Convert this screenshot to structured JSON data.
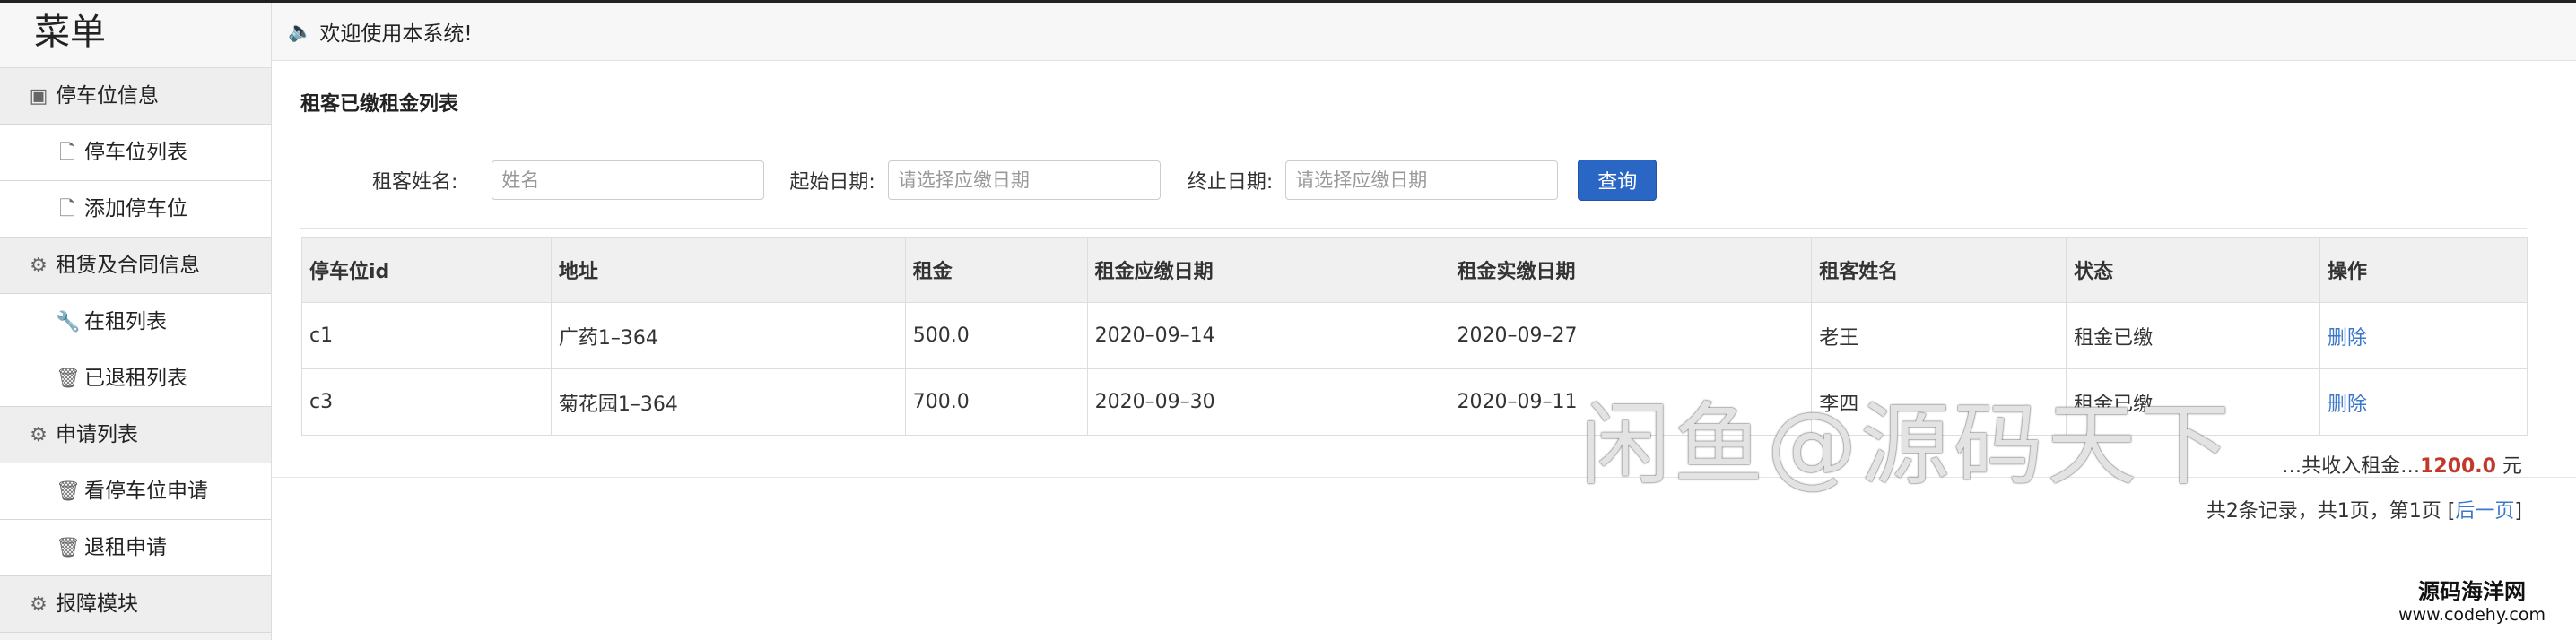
{
  "sidebar": {
    "title": "菜单",
    "items": [
      {
        "type": "head",
        "icon": "panel-icon",
        "glyph": "▣",
        "label": "停车位信息"
      },
      {
        "type": "sub",
        "icon": "file-icon",
        "glyph": "🗋",
        "label": "停车位列表"
      },
      {
        "type": "sub",
        "icon": "file-icon",
        "glyph": "🗋",
        "label": "添加停车位"
      },
      {
        "type": "head",
        "icon": "gear-icon",
        "glyph": "⚙",
        "label": "租赁及合同信息"
      },
      {
        "type": "sub",
        "icon": "wrench-icon",
        "glyph": "🔧",
        "label": "在租列表"
      },
      {
        "type": "sub",
        "icon": "trash-icon",
        "glyph": "🗑",
        "label": "已退租列表"
      },
      {
        "type": "head",
        "icon": "gear-icon",
        "glyph": "⚙",
        "label": "申请列表"
      },
      {
        "type": "sub",
        "icon": "trash-icon",
        "glyph": "🗑",
        "label": "看停车位申请"
      },
      {
        "type": "sub",
        "icon": "trash-icon",
        "glyph": "🗑",
        "label": "退租申请"
      },
      {
        "type": "head",
        "icon": "gear-icon",
        "glyph": "⚙",
        "label": "报障模块"
      }
    ]
  },
  "header": {
    "welcome": "欢迎使用本系统!",
    "speaker_icon": "speaker-icon"
  },
  "main": {
    "title": "租客已缴租金列表",
    "search": {
      "name_label": "租客姓名:",
      "name_placeholder": "姓名",
      "name_value": "",
      "start_label": "起始日期:",
      "start_placeholder": "请选择应缴日期",
      "start_value": "",
      "end_label": "终止日期:",
      "end_placeholder": "请选择应缴日期",
      "end_value": "",
      "button": "查询"
    },
    "table": {
      "columns": [
        "停车位id",
        "地址",
        "租金",
        "租金应缴日期",
        "租金实缴日期",
        "租客姓名",
        "状态",
        "操作"
      ],
      "rows": [
        [
          "c1",
          "广药1–364",
          "500.0",
          "2020–09–14",
          "2020–09–27",
          "老王",
          "租金已缴",
          "删除"
        ],
        [
          "c3",
          "菊花园1–364",
          "700.0",
          "2020–09–30",
          "2020–09–11",
          "李四",
          "租金已缴",
          "删除"
        ]
      ]
    },
    "summary": {
      "prefix": "…共收入租金…",
      "amount": "1200.0",
      "unit": "元"
    },
    "pager": {
      "text": "共2条记录，共1页，第1页",
      "next": "后一页"
    }
  },
  "watermark": "闲鱼@源码天下",
  "brand": {
    "line1": "源码海洋网",
    "line2": "www.codehy.com"
  },
  "colors": {
    "primary_button": "#2a66c4",
    "link": "#3c78c8",
    "amount": "#c0392b"
  }
}
